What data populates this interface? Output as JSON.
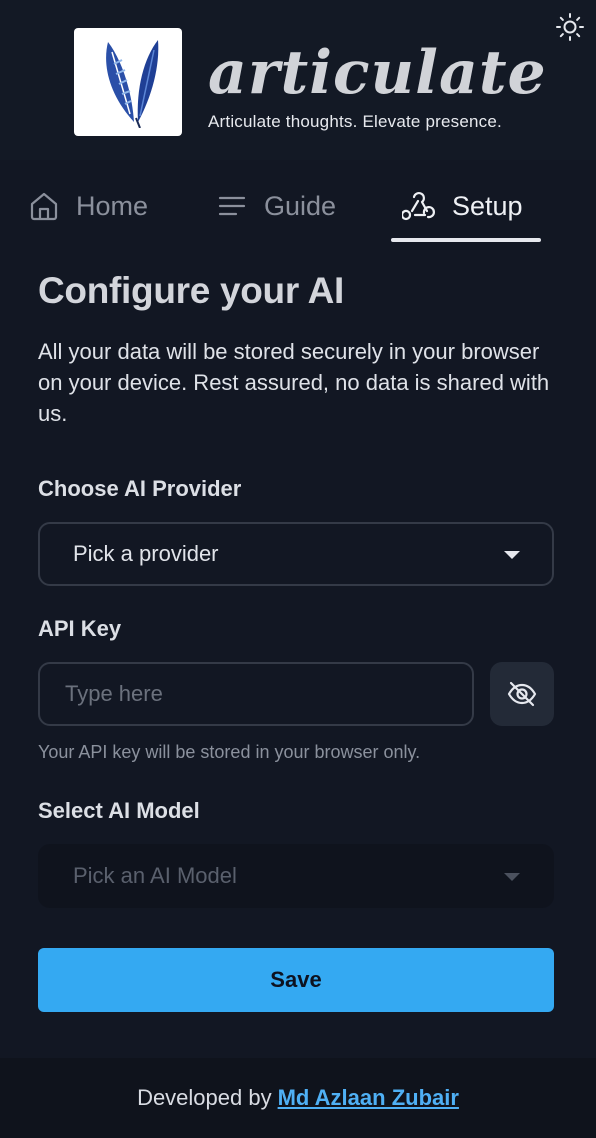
{
  "header": {
    "brand": "articulate",
    "tagline": "Articulate thoughts. Elevate presence.",
    "theme_icon": "sun-icon"
  },
  "tabs": [
    {
      "label": "Home",
      "icon": "home-icon",
      "active": false
    },
    {
      "label": "Guide",
      "icon": "menu-lines-icon",
      "active": false
    },
    {
      "label": "Setup",
      "icon": "webhook-icon",
      "active": true
    }
  ],
  "setup": {
    "title": "Configure your AI",
    "description": "All your data will be stored securely in your browser on your device. Rest assured, no data is shared with us.",
    "provider_label": "Choose AI Provider",
    "provider_value": "Pick a provider",
    "api_key_label": "API Key",
    "api_key_placeholder": "Type here",
    "api_key_help": "Your API key will be stored in your browser only.",
    "model_label": "Select AI Model",
    "model_value": "Pick an AI Model",
    "save_label": "Save"
  },
  "footer": {
    "prefix": "Developed by",
    "author": "Md Azlaan Zubair"
  },
  "colors": {
    "background": "#121723",
    "accent": "#34a9f2",
    "link": "#4fb0f5"
  }
}
